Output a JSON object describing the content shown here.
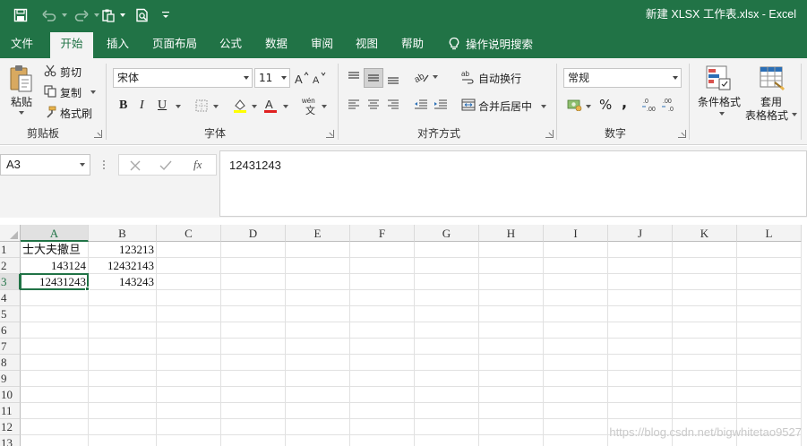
{
  "title_bar": {
    "document_title": "新建 XLSX 工作表.xlsx  -  Excel",
    "quick_access": [
      "save-icon",
      "undo-icon",
      "redo-icon",
      "paste-icon",
      "print-preview-icon",
      "customize-icon"
    ]
  },
  "tabs": [
    {
      "label": "文件",
      "active": false
    },
    {
      "label": "开始",
      "active": true
    },
    {
      "label": "插入",
      "active": false
    },
    {
      "label": "页面布局",
      "active": false
    },
    {
      "label": "公式",
      "active": false
    },
    {
      "label": "数据",
      "active": false
    },
    {
      "label": "审阅",
      "active": false
    },
    {
      "label": "视图",
      "active": false
    },
    {
      "label": "帮助",
      "active": false
    }
  ],
  "tell_me": "操作说明搜索",
  "ribbon": {
    "clipboard": {
      "label": "剪贴板",
      "paste": "粘贴",
      "cut": "剪切",
      "copy": "复制",
      "format_painter": "格式刷"
    },
    "font": {
      "label": "字体",
      "font_name": "宋体",
      "font_size": "11",
      "bold": "B",
      "italic": "I",
      "underline": "U"
    },
    "alignment": {
      "label": "对齐方式",
      "wrap_text": "自动换行",
      "merge_center": "合并后居中"
    },
    "number": {
      "label": "数字",
      "format": "常规",
      "percent": "%",
      "comma": ","
    },
    "styles": {
      "conditional_format": "条件格式",
      "table_format_line1": "套用",
      "table_format_line2": "表格格式"
    }
  },
  "formula_bar": {
    "name_box": "A3",
    "fx": "fx",
    "formula": "12431243"
  },
  "sheet": {
    "columns": [
      "A",
      "B",
      "C",
      "D",
      "E",
      "F",
      "G",
      "H",
      "I",
      "J",
      "K",
      "L"
    ],
    "rows": [
      "1",
      "2",
      "3",
      "4",
      "5",
      "6",
      "7",
      "8",
      "9",
      "10",
      "11",
      "12",
      "13"
    ],
    "cells": {
      "A1": "士大夫撒旦",
      "B1": "123213",
      "A2": "143124",
      "B2": "12432143",
      "A3": "12431243",
      "B3": "143243"
    },
    "active_cell": "A3",
    "active_column": "A",
    "active_row": "3"
  },
  "watermark": "https://blog.csdn.net/bigwhitetao9527",
  "colors": {
    "accent": "#217346",
    "ribbon_bg": "#f3f3f3",
    "gridline": "#e1e1e1"
  }
}
